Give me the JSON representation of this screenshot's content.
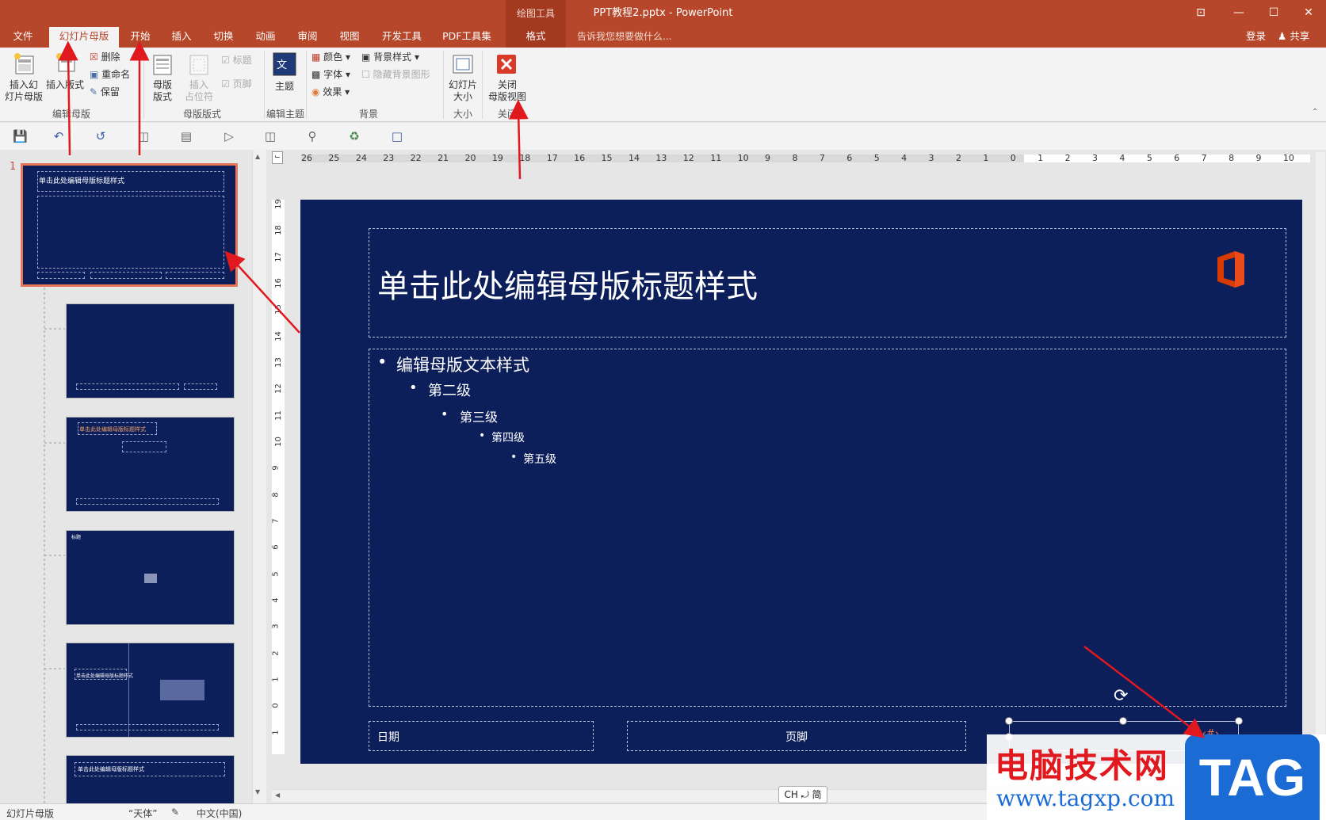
{
  "titlebar": {
    "context_label": "绘图工具",
    "title": "PPT教程2.pptx - PowerPoint",
    "buttons": [
      "⊡",
      "—",
      "☐",
      "✕"
    ]
  },
  "tabs": {
    "items": [
      "文件",
      "幻灯片母版",
      "开始",
      "插入",
      "切换",
      "动画",
      "审阅",
      "视图",
      "开发工具",
      "PDF工具集",
      "格式"
    ],
    "active": "幻灯片母版",
    "tell_me": "告诉我您想要做什么...",
    "signin": "登录",
    "share": "共享"
  },
  "ribbon": {
    "insert_master": "插入幻\n灯片母版",
    "insert_layout": "插入版式",
    "delete": "删除",
    "rename": "重命名",
    "preserve": "保留",
    "group_edit_master": "编辑母版",
    "master_layout": "母版\n版式",
    "insert_placeholder": "插入\n占位符",
    "title_check": "标题",
    "footer_check": "页脚",
    "group_master_layout": "母版版式",
    "theme": "主题",
    "group_edit_theme": "编辑主题",
    "colors": "颜色",
    "fonts": "字体",
    "effects": "效果",
    "bg_styles": "背景样式",
    "hide_bg": "隐藏背景图形",
    "group_background": "背景",
    "slide_size": "幻灯片\n大小",
    "group_size": "大小",
    "close_master": "关闭\n母版视图",
    "group_close": "关闭"
  },
  "thumbnails": {
    "first_number": "1",
    "thumb1_title": "单击此处编辑母版标题样式",
    "thumb3_title": "单击此处编辑母版标题样式",
    "thumb5_title": "单击此处编辑母版标题样式",
    "thumb6_title": "单击此处编辑母版标题样式",
    "thumb4_label": "标题"
  },
  "ruler": {
    "h_labels": [
      "26",
      "25",
      "24",
      "23",
      "22",
      "21",
      "20",
      "19",
      "18",
      "17",
      "16",
      "15",
      "14",
      "13",
      "12",
      "11",
      "10",
      "9",
      "8",
      "7",
      "6",
      "5",
      "4",
      "3",
      "2",
      "1",
      "0",
      "1",
      "2",
      "3",
      "4",
      "5",
      "6",
      "7",
      "8",
      "9",
      "10"
    ],
    "v_labels": [
      "19",
      "18",
      "17",
      "16",
      "15",
      "14",
      "13",
      "12",
      "11",
      "10",
      "9",
      "8",
      "7",
      "6",
      "5",
      "4",
      "3",
      "2",
      "1",
      "0",
      "1"
    ]
  },
  "slide": {
    "title": "单击此处编辑母版标题样式",
    "level1": "编辑母版文本样式",
    "level2": "第二级",
    "level3": "第三级",
    "level4": "第四级",
    "level5": "第五级",
    "date": "日期",
    "footer": "页脚",
    "slide_number": "‹#›"
  },
  "ime": "CH ⤾ 简",
  "status": {
    "view": "幻灯片母版",
    "theme": "“天体”",
    "language": "中文(中国)"
  },
  "watermark": {
    "cn": "电脑技术网",
    "url": "www.tagxp.com",
    "tag": "TAG"
  },
  "colors": {
    "accent": "#b7472a",
    "slide_bg": "#0c1f5b",
    "arrow": "#e0191f"
  }
}
